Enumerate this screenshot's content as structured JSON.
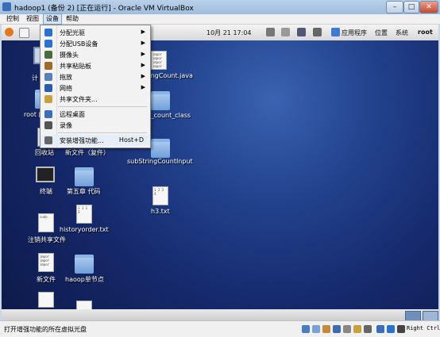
{
  "window": {
    "title": "hadoop1 (备份 2) [正在运行] - Oracle VM VirtualBox",
    "minimize": "–",
    "maximize": "□",
    "close": "✕"
  },
  "menubar": [
    "控制",
    "视图",
    "设备",
    "帮助"
  ],
  "guest_panel": {
    "date": "10月 21 17:04",
    "apps": "应用程序",
    "places": "位置",
    "system": "系统",
    "user": "root"
  },
  "device_menu": {
    "items": [
      {
        "label": "分配光驱",
        "has_submenu": true,
        "icon": "optical-drive-icon",
        "color": "#2a73c9"
      },
      {
        "label": "分配USB设备",
        "has_submenu": true,
        "icon": "usb-icon",
        "color": "#2a73c9"
      },
      {
        "label": "摄像头",
        "has_submenu": true,
        "icon": "webcam-icon",
        "color": "#4b6b3a"
      },
      {
        "label": "共享粘贴板",
        "has_submenu": true,
        "icon": "clipboard-icon",
        "color": "#a06a2a"
      },
      {
        "label": "拖放",
        "has_submenu": true,
        "icon": "drag-drop-icon",
        "color": "#5b80b3"
      },
      {
        "label": "网络",
        "has_submenu": true,
        "icon": "network-icon",
        "color": "#2a5da8"
      },
      {
        "label": "共享文件夹...",
        "has_submenu": false,
        "icon": "shared-folder-icon",
        "color": "#c7a040"
      },
      {
        "label": "远程桌面",
        "has_submenu": false,
        "icon": "remote-desktop-icon",
        "color": "#3a6fb8"
      },
      {
        "label": "录像",
        "has_submenu": false,
        "icon": "video-capture-icon",
        "color": "#555555"
      },
      {
        "label": "安装增强功能...",
        "has_submenu": false,
        "icon": "guest-additions-icon",
        "color": "#666666",
        "shortcut": "Host+D"
      }
    ]
  },
  "desktop_icons": [
    {
      "label": "计",
      "type": "computer"
    },
    {
      "label": "root 的",
      "type": "folder"
    },
    {
      "label": "回收站",
      "type": "trash"
    },
    {
      "label": "终端",
      "type": "terminal"
    },
    {
      "label": "注销共享文件",
      "type": "doc",
      "snippet": "sudo"
    },
    {
      "label": "新文件",
      "type": "doc",
      "snippet": "impor impor impor"
    },
    {
      "label": "新文件（复件）",
      "type": "doc",
      "snippet": ""
    },
    {
      "label": "第五章 代码",
      "type": "folder"
    },
    {
      "label": "historyorder.txt",
      "type": "doc",
      "snippet": "1 1 1 3"
    },
    {
      "label": "haoop单节点",
      "type": "folder"
    },
    {
      "label": "StringCount.java",
      "type": "doc",
      "snippet": "impor impor impor impor"
    },
    {
      "label": "ring_count_class",
      "type": "folder"
    },
    {
      "label": "subStringCountInput",
      "type": "folder"
    },
    {
      "label": "h3.txt",
      "type": "doc",
      "snippet": "1 2 3 4"
    }
  ],
  "statusbar": {
    "text": "打开增强功能的所在虚拟光盘",
    "hostkey": "Right Ctrl"
  }
}
